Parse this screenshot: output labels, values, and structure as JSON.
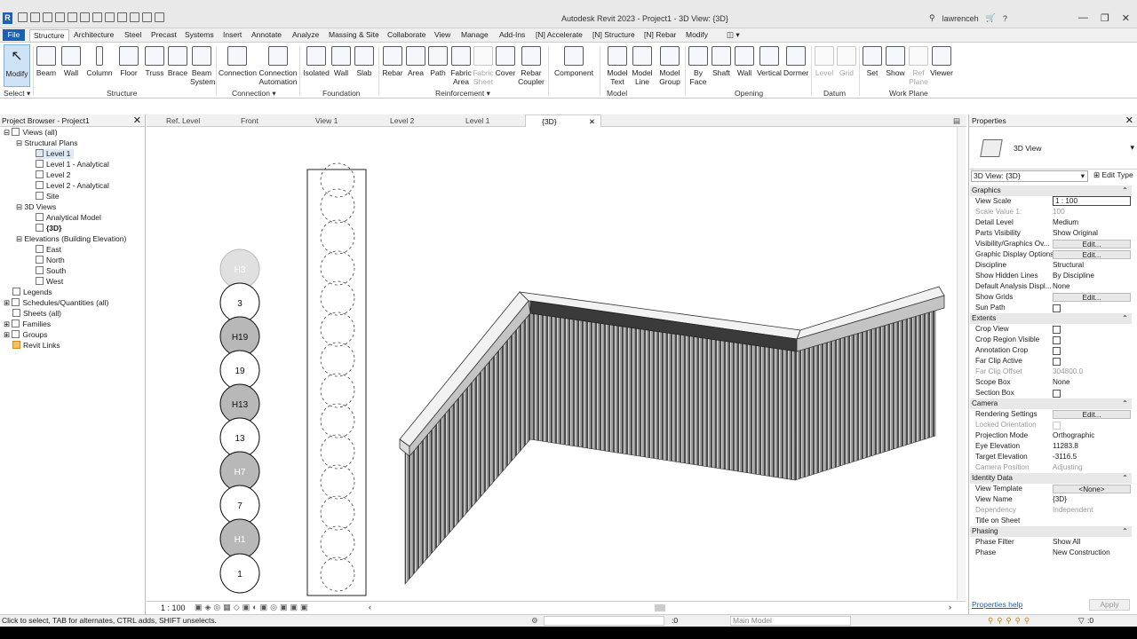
{
  "window": {
    "title": "Autodesk Revit 2023 - Project1 - 3D View: {3D}",
    "user": "lawrenceh"
  },
  "tabs": [
    "File",
    "Structure",
    "Architecture",
    "Steel",
    "Precast",
    "Systems",
    "Insert",
    "Annotate",
    "Analyze",
    "Massing & Site",
    "Collaborate",
    "View",
    "Manage",
    "Add-Ins",
    "[N] Accelerate",
    "[N] Structure",
    "[N] Rebar",
    "Modify"
  ],
  "ribbon": {
    "select": "Select",
    "buttons": {
      "modify": "Modify",
      "beam": "Beam",
      "wall": "Wall",
      "column": "Column",
      "floor": "Floor",
      "truss": "Truss",
      "brace": "Brace",
      "beam_system_1": "Beam",
      "beam_system_2": "System",
      "connection": "Connection",
      "conn_auto_1": "Connection",
      "conn_auto_2": "Automation",
      "isolated": "Isolated",
      "fwall": "Wall",
      "slab": "Slab",
      "rebar": "Rebar",
      "area": "Area",
      "path": "Path",
      "fabric_area_1": "Fabric",
      "fabric_area_2": "Area",
      "fabric_sheet_1": "Fabric",
      "fabric_sheet_2": "Sheet",
      "cover": "Cover",
      "rebar_coupler_1": "Rebar",
      "rebar_coupler_2": "Coupler",
      "component": "Component",
      "model_text_1": "Model",
      "model_text_2": "Text",
      "model_line_1": "Model",
      "model_line_2": "Line",
      "model_group_1": "Model",
      "model_group_2": "Group",
      "by_face_1": "By",
      "by_face_2": "Face",
      "shaft": "Shaft",
      "owall": "Wall",
      "vertical": "Vertical",
      "dormer": "Dormer",
      "level": "Level",
      "grid": "Grid",
      "set": "Set",
      "show": "Show",
      "ref_plane_1": "Ref",
      "ref_plane_2": "Plane",
      "viewer": "Viewer"
    },
    "panels": {
      "structure": "Structure",
      "connection": "Connection",
      "foundation": "Foundation",
      "reinforcement": "Reinforcement",
      "model": "Model",
      "opening": "Opening",
      "datum": "Datum",
      "work_plane": "Work Plane"
    }
  },
  "project_browser": {
    "title": "Project Browser - Project1",
    "items": [
      "Views (all)",
      "Structural Plans",
      "Level 1",
      "Level 1 - Analytical",
      "Level 2",
      "Level 2 - Analytical",
      "Site",
      "3D Views",
      "Analytical Model",
      "{3D}",
      "Elevations (Building Elevation)",
      "East",
      "North",
      "South",
      "West",
      "Legends",
      "Schedules/Quantities (all)",
      "Sheets (all)",
      "Families",
      "Groups",
      "Revit Links"
    ]
  },
  "view_tabs": [
    "Ref. Level",
    "Front",
    "View 1",
    "Level 2",
    "Level 1",
    "{3D}"
  ],
  "piles": [
    "H3",
    "3",
    "H19",
    "19",
    "H13",
    "13",
    "H7",
    "7",
    "H1",
    "1"
  ],
  "view_scale": "1 : 100",
  "properties": {
    "title": "Properties",
    "type_name": "3D View",
    "instance": "3D View: {3D}",
    "edit_type": "Edit Type",
    "rows": [
      {
        "k": "Graphics",
        "group": true
      },
      {
        "k": "View Scale",
        "v": "1 : 100",
        "input": true
      },
      {
        "k": "Scale Value    1:",
        "v": "100",
        "dim": true
      },
      {
        "k": "Detail Level",
        "v": "Medium"
      },
      {
        "k": "Parts Visibility",
        "v": "Show Original"
      },
      {
        "k": "Visibility/Graphics Ov...",
        "v": "Edit...",
        "btn": true
      },
      {
        "k": "Graphic Display Options",
        "v": "Edit...",
        "btn": true
      },
      {
        "k": "Discipline",
        "v": "Structural"
      },
      {
        "k": "Show Hidden Lines",
        "v": "By Discipline"
      },
      {
        "k": "Default Analysis Displ...",
        "v": "None"
      },
      {
        "k": "Show Grids",
        "v": "Edit...",
        "btn": true
      },
      {
        "k": "Sun Path",
        "chk": true
      },
      {
        "k": "Extents",
        "group": true
      },
      {
        "k": "Crop View",
        "chk": true
      },
      {
        "k": "Crop Region Visible",
        "chk": true
      },
      {
        "k": "Annotation Crop",
        "chk": true
      },
      {
        "k": "Far Clip Active",
        "chk": true
      },
      {
        "k": "Far Clip Offset",
        "v": "304800.0",
        "dim": true
      },
      {
        "k": "Scope Box",
        "v": "None"
      },
      {
        "k": "Section Box",
        "chk": true
      },
      {
        "k": "Camera",
        "group": true
      },
      {
        "k": "Rendering Settings",
        "v": "Edit...",
        "btn": true
      },
      {
        "k": "Locked Orientation",
        "dim": true,
        "chk": true
      },
      {
        "k": "Projection Mode",
        "v": "Orthographic"
      },
      {
        "k": "Eye Elevation",
        "v": "11283.8"
      },
      {
        "k": "Target Elevation",
        "v": "-3116.5"
      },
      {
        "k": "Camera Position",
        "v": "Adjusting",
        "dim": true
      },
      {
        "k": "Identity Data",
        "group": true
      },
      {
        "k": "View Template",
        "v": "<None>",
        "btn": true
      },
      {
        "k": "View Name",
        "v": "{3D}"
      },
      {
        "k": "Dependency",
        "v": "Independent",
        "dim": true
      },
      {
        "k": "Title on Sheet",
        "v": ""
      },
      {
        "k": "Phasing",
        "group": true
      },
      {
        "k": "Phase Filter",
        "v": "Show All"
      },
      {
        "k": "Phase",
        "v": "New Construction"
      }
    ],
    "help": "Properties help",
    "apply": "Apply"
  },
  "status": {
    "hint": "Click to select, TAB for alternates, CTRL adds, SHIFT unselects.",
    "zero": ":0",
    "model": "Main Model",
    "filter": ":0"
  }
}
